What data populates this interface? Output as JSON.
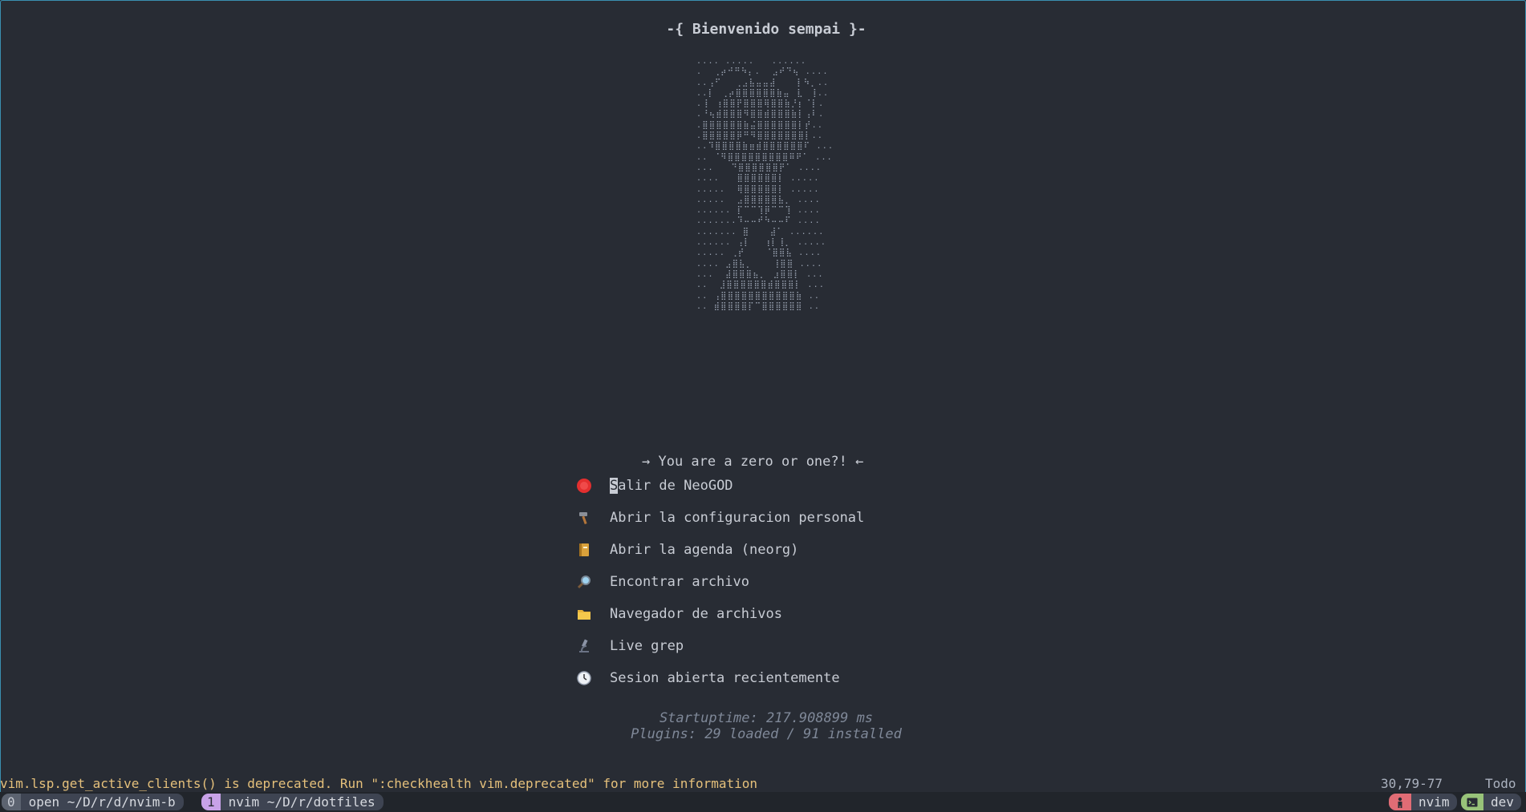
{
  "dashboard": {
    "header": "-{ Bienvenido sempai }-",
    "ascii_art": ".... .....   ......\n.  ⢀⡴⠚⠛⠳⡄.  ⣠⠞⠙⢦ ....\n..⢠⠋⠀⠀⢀⣠⣧⣤⣤⣼⠀⠀⠀⡇⠳⡀..\n..⡇⠀⢀⡴⣿⣿⣿⣿⣿⣿⣷⣤⠀⣇⠀⢸..\n.⢸⠀⢰⣿⣿⡟⣿⣿⣿⢿⣿⣿⣷⡘⡆⠈⡇.\n.⠘⢦⣾⣿⣿⣿⠻⣿⣿⣾⣿⣿⣿⣷⡇⢠⠇.\n.⣿⣿⣿⣿⣿⣿⣷⣬⣿⣿⣿⣿⣿⣿⡇⡞..\n.⣿⣿⣿⣿⣿⡿⠛⠻⣿⣿⣿⣿⣿⣿⣿⡇..\n..⠹⣿⣿⣿⣿⣷⣶⣾⣿⣿⣿⣿⣿⣿⠏ ...\n.. ⠈⠻⣿⣿⣿⣿⣿⣿⣿⣿⣿⠿⠟⠁ ...\n...   ⠙⣿⣿⣿⣿⣿⣿⡟⠁ ....\n....   ⣿⣿⣿⣿⣿⣿⡇ .....\n.....  ⢿⣿⣿⣿⣿⣿⡇ .....\n.....  ⣠⣿⣿⣿⣿⣿⣧⡀ ....\n...... ⡏⠉⠉⢹⡿⠉⠉⢹ ....\n.......⠹⠤⠤⠞⠳⠤⠤⠏ ....\n....... ⣿⠀⠀⠀⣼⠁ ......\n...... ⢠⡇⠀⠀⢰⡇⢸⡀ .....\n..... ⢀⡞⠀⠀⠀⠈⣿⣿⣧ ....\n.... ⣠⣿⣧⡀⠀⠀⠀⢸⣿⣿ ....\n...  ⣼⣿⣿⣿⣦⡀⠀⣰⣿⣿⡇ ...\n..  ⣸⣿⣿⣿⣿⣿⣿⣾⣿⣿⣿⡇ ...\n.. ⢠⣿⣿⣿⣿⣿⣿⣿⣿⣿⣿⣿⣷ ..\n.. ⣾⣿⣿⣿⣿⡏⠉⣿⣿⣿⣿⣿⣿ ..",
    "tagline": "→ You are a zero or one?! ←",
    "menu": [
      {
        "cursor": "S",
        "label": "alir de NeoGOD",
        "icon": "stop-sign-icon"
      },
      {
        "label": "Abrir la configuracion personal",
        "icon": "hammer-icon"
      },
      {
        "label": "Abrir la agenda (neorg)",
        "icon": "notebook-icon"
      },
      {
        "label": "Encontrar archivo",
        "icon": "magnifier-icon"
      },
      {
        "label": "Navegador de archivos",
        "icon": "folder-icon"
      },
      {
        "label": "Live grep",
        "icon": "microscope-icon"
      },
      {
        "label": "Sesion abierta recientemente",
        "icon": "clock-icon"
      }
    ],
    "startup": "Startuptime: 217.908899 ms",
    "plugins": "Plugins: 29 loaded / 91 installed"
  },
  "cmdline": {
    "message": "vim.lsp.get_active_clients() is deprecated. Run \":checkhealth vim.deprecated\" for more information",
    "position": "30,79-77",
    "scroll": "Todo"
  },
  "tmux": {
    "windows": [
      {
        "index": "0",
        "name": "open ~/D/r/d/nvim-b"
      },
      {
        "index": "1",
        "name": "nvim ~/D/r/dotfiles"
      }
    ],
    "right": [
      {
        "icon": "person-icon",
        "label": "nvim"
      },
      {
        "icon": "terminal-icon",
        "label": "dev"
      }
    ]
  },
  "colors": {
    "background": "#282c34",
    "warning": "#e5c07b",
    "active_window": "#c8a2e8",
    "process_badge": "#e06c75",
    "session_badge": "#98c379"
  }
}
